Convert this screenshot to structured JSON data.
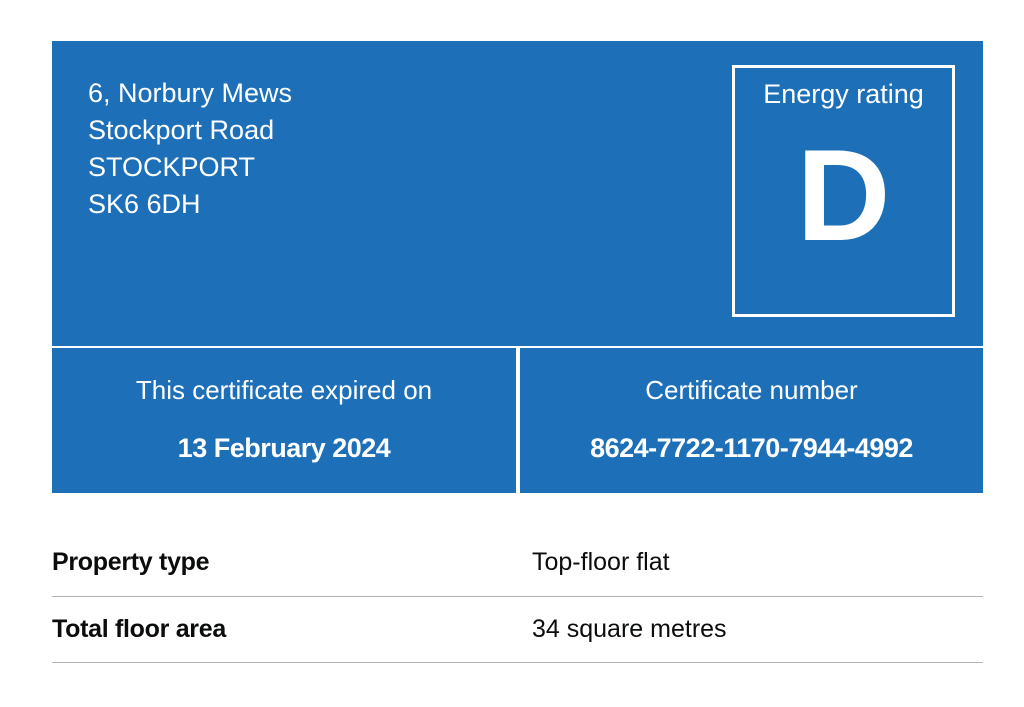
{
  "address": {
    "line1": "6, Norbury Mews",
    "line2": "Stockport Road",
    "line3": "STOCKPORT",
    "postcode": "SK6 6DH"
  },
  "energy_rating": {
    "label": "Energy rating",
    "value": "D"
  },
  "certificate": {
    "expiry_label": "This certificate expired on",
    "expiry_date": "13 February 2024",
    "number_label": "Certificate number",
    "number": "8624-7722-1170-7944-4992"
  },
  "summary": {
    "rows": [
      {
        "key": "Property type",
        "value": "Top-floor flat"
      },
      {
        "key": "Total floor area",
        "value": "34 square metres"
      }
    ]
  },
  "colors": {
    "panel_blue": "#1d70b8",
    "text_dark": "#0b0c0c",
    "divider": "#b1b4b6"
  }
}
